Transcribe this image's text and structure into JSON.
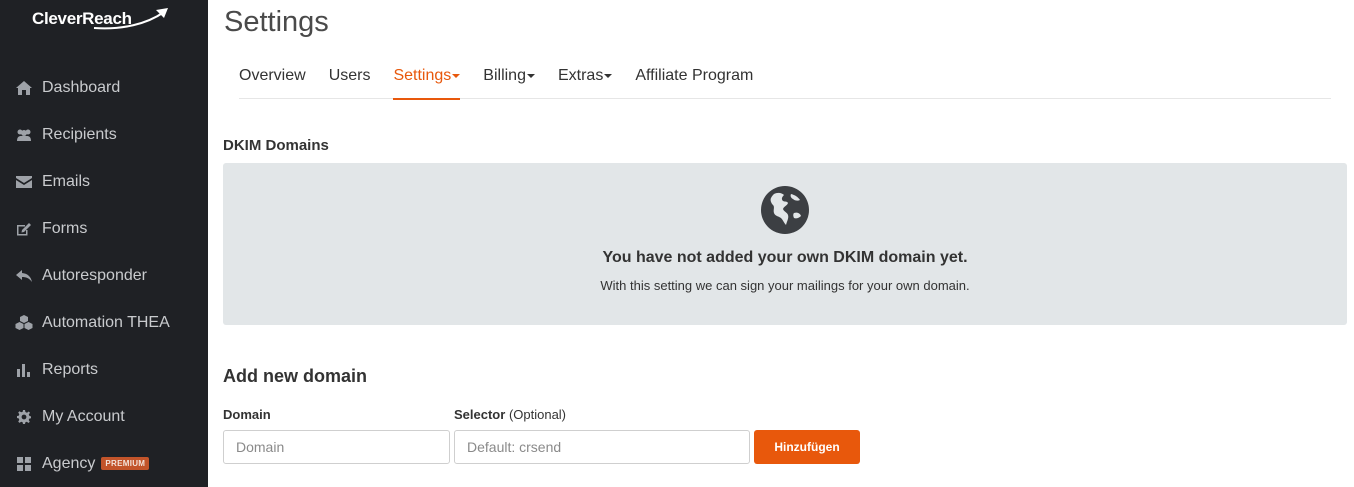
{
  "brand": {
    "name": "CleverReach",
    "accent": "#e8580c",
    "sidebar_bg": "#1f2125"
  },
  "sidebar": {
    "items": [
      {
        "label": "Dashboard",
        "icon": "home-icon"
      },
      {
        "label": "Recipients",
        "icon": "users-icon"
      },
      {
        "label": "Emails",
        "icon": "envelope-icon"
      },
      {
        "label": "Forms",
        "icon": "edit-icon"
      },
      {
        "label": "Autoresponder",
        "icon": "reply-icon"
      },
      {
        "label": "Automation THEA",
        "icon": "cubes-icon"
      },
      {
        "label": "Reports",
        "icon": "bar-chart-icon"
      },
      {
        "label": "My Account",
        "icon": "gear-icon"
      },
      {
        "label": "Agency",
        "icon": "grid-icon",
        "badge": "PREMIUM"
      }
    ]
  },
  "page": {
    "title": "Settings"
  },
  "tabs": [
    {
      "label": "Overview",
      "dropdown": false,
      "active": false
    },
    {
      "label": "Users",
      "dropdown": false,
      "active": false
    },
    {
      "label": "Settings",
      "dropdown": true,
      "active": true
    },
    {
      "label": "Billing",
      "dropdown": true,
      "active": false
    },
    {
      "label": "Extras",
      "dropdown": true,
      "active": false
    },
    {
      "label": "Affiliate Program",
      "dropdown": false,
      "active": false
    }
  ],
  "dkim": {
    "section_title": "DKIM Domains",
    "empty_icon": "globe-icon",
    "empty_title": "You have not added your own DKIM domain yet.",
    "empty_subtitle": "With this setting we can sign your mailings for your own domain."
  },
  "add_domain": {
    "title": "Add new domain",
    "domain_label": "Domain",
    "domain_placeholder": "Domain",
    "domain_value": "",
    "selector_label": "Selector",
    "selector_optional": "(Optional)",
    "selector_placeholder": "Default: crsend",
    "selector_value": "",
    "submit_label": "Hinzufügen"
  }
}
